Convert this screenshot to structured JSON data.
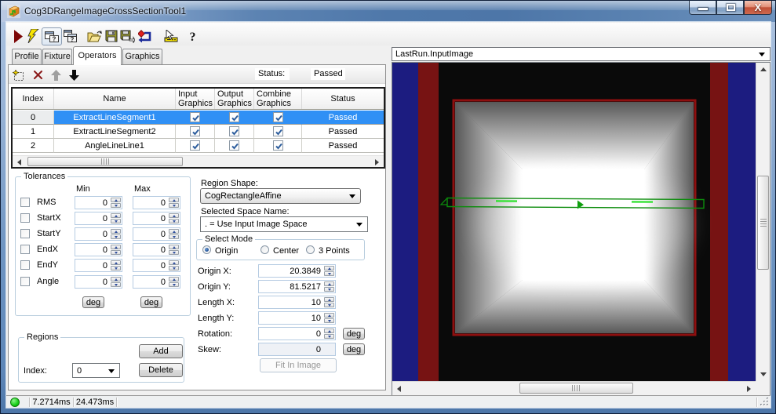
{
  "window": {
    "title": "Cog3DRangeImageCrossSectionTool1",
    "controls": [
      "minimize",
      "maximize",
      "close"
    ]
  },
  "toolbar": {
    "icons": [
      "run-icon",
      "trigger-lightning-icon",
      "show-result-toggle-icon",
      "float-result-icon",
      "open-file-icon",
      "save-icon",
      "save-results-icon",
      "reset-icon",
      "electrode-icon",
      "help-icon"
    ]
  },
  "tabs": {
    "items": [
      {
        "label": "Profile"
      },
      {
        "label": "Fixture"
      },
      {
        "label": "Operators",
        "active": true
      },
      {
        "label": "Graphics"
      }
    ]
  },
  "operator_strip": {
    "icons": [
      "new-operator-icon",
      "delete-operator-icon",
      "move-up-icon",
      "move-down-icon"
    ],
    "status_label": "Status:",
    "status_value": "Passed"
  },
  "operator_table": {
    "columns": [
      "Index",
      "Name",
      "Input Graphics",
      "Output Graphics",
      "Combine Graphics",
      "Status"
    ],
    "rows": [
      {
        "index": "0",
        "name": "ExtractLineSegment1",
        "input_graphics": true,
        "output_graphics": true,
        "combine_graphics": true,
        "status": "Passed",
        "selected": true
      },
      {
        "index": "1",
        "name": "ExtractLineSegment2",
        "input_graphics": true,
        "output_graphics": true,
        "combine_graphics": true,
        "status": "Passed",
        "selected": false
      },
      {
        "index": "2",
        "name": "AngleLineLine1",
        "input_graphics": true,
        "output_graphics": true,
        "combine_graphics": true,
        "status": "Passed",
        "selected": false
      }
    ]
  },
  "tolerances": {
    "title": "Tolerances",
    "min_header": "Min",
    "max_header": "Max",
    "deg_min_label": "deg",
    "deg_max_label": "deg",
    "rows": [
      {
        "label": "RMS",
        "min": "0",
        "max": "0",
        "checked": false
      },
      {
        "label": "StartX",
        "min": "0",
        "max": "0",
        "checked": false
      },
      {
        "label": "StartY",
        "min": "0",
        "max": "0",
        "checked": false
      },
      {
        "label": "EndX",
        "min": "0",
        "max": "0",
        "checked": false
      },
      {
        "label": "EndY",
        "min": "0",
        "max": "0",
        "checked": false
      },
      {
        "label": "Angle",
        "min": "0",
        "max": "0",
        "checked": false
      }
    ]
  },
  "region_shape": {
    "label": "Region Shape:",
    "value": "CogRectangleAffine"
  },
  "space_name": {
    "label": "Selected Space Name:",
    "value": ". = Use Input Image Space"
  },
  "select_mode": {
    "title": "Select Mode",
    "options": [
      {
        "label": "Origin",
        "selected": true
      },
      {
        "label": "Center",
        "selected": false
      },
      {
        "label": "3 Points",
        "selected": false
      }
    ]
  },
  "params": {
    "origin_x": {
      "label": "Origin X:",
      "value": "20.3849"
    },
    "origin_y": {
      "label": "Origin Y:",
      "value": "81.5217"
    },
    "length_x": {
      "label": "Length X:",
      "value": "10"
    },
    "length_y": {
      "label": "Length Y:",
      "value": "10"
    },
    "rotation": {
      "label": "Rotation:",
      "value": "0",
      "deg_label": "deg"
    },
    "skew": {
      "label": "Skew:",
      "value": "0",
      "deg_label": "deg",
      "disabled": true
    },
    "fit_button": "Fit In Image"
  },
  "regions": {
    "title": "Regions",
    "add_label": "Add",
    "delete_label": "Delete",
    "index_label": "Index:",
    "index_value": "0"
  },
  "display": {
    "selector_value": "LastRun.InputImage"
  },
  "statusbar": {
    "time1": "7.2714ms",
    "time2": "24.473ms"
  },
  "colors": {
    "selection_blue": "#3090f5",
    "status_green": "#17cf17",
    "stripe_blue": "#1c1c80",
    "stripe_red": "#771313",
    "square_gray": "#5a5a5a",
    "square_border_red": "#8e0f0f",
    "graphic_green": "#0c8c0c"
  }
}
